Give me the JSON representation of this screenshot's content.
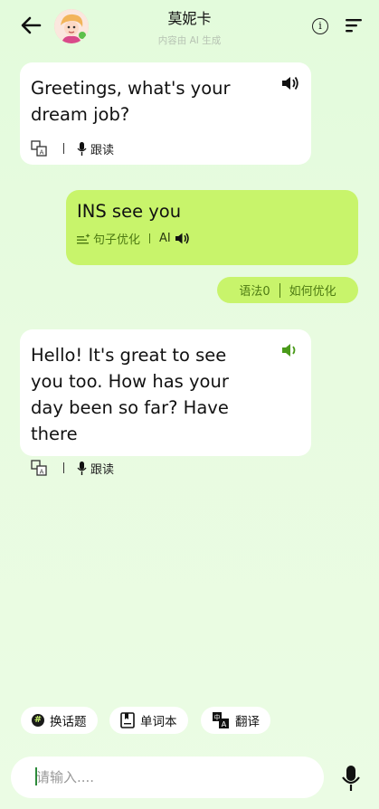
{
  "header": {
    "name": "莫妮卡",
    "subtitle": "内容由 AI 生成",
    "info_glyph": "i"
  },
  "messages": [
    {
      "role": "ai",
      "text": "Greetings, what's your dream job?",
      "follow_label": "跟读",
      "speaker_color": "#111111"
    },
    {
      "role": "user",
      "text": "INS see you",
      "optimize_label": "句子优化",
      "ai_label": "AI"
    },
    {
      "role": "ai",
      "text": "Hello! It's great to see you too. How has your day been so far? Have there",
      "follow_label": "跟读",
      "speaker_color": "#4a9a1a"
    }
  ],
  "grammar": {
    "count_label": "语法0",
    "how_label": "如何优化"
  },
  "chips": {
    "topic": "换话题",
    "wordbook": "单词本",
    "translate": "翻译"
  },
  "input": {
    "placeholder": "请输入...."
  },
  "colors": {
    "accent": "#c8f46b",
    "accent_text": "#4d7a12",
    "background": "#e5fbde"
  }
}
